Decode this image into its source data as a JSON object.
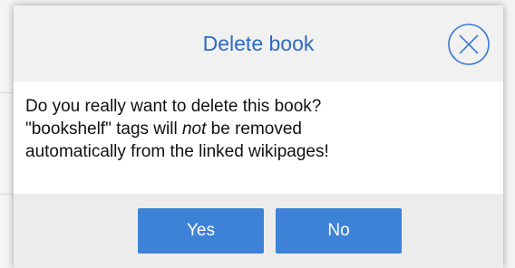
{
  "dialog": {
    "title": "Delete book",
    "close_icon": "circle-x-icon",
    "message": {
      "line1": "Do you really want to delete this book?",
      "line2_prefix": "\"bookshelf\" tags will ",
      "line2_emphasis": "not",
      "line2_suffix": " be removed",
      "line3": "automatically from the linked wikipages!"
    },
    "buttons": {
      "yes_label": "Yes",
      "no_label": "No"
    }
  },
  "colors": {
    "title": "#2e6bc6",
    "button": "#3d82d6",
    "close_icon": "#3a7bd5"
  }
}
